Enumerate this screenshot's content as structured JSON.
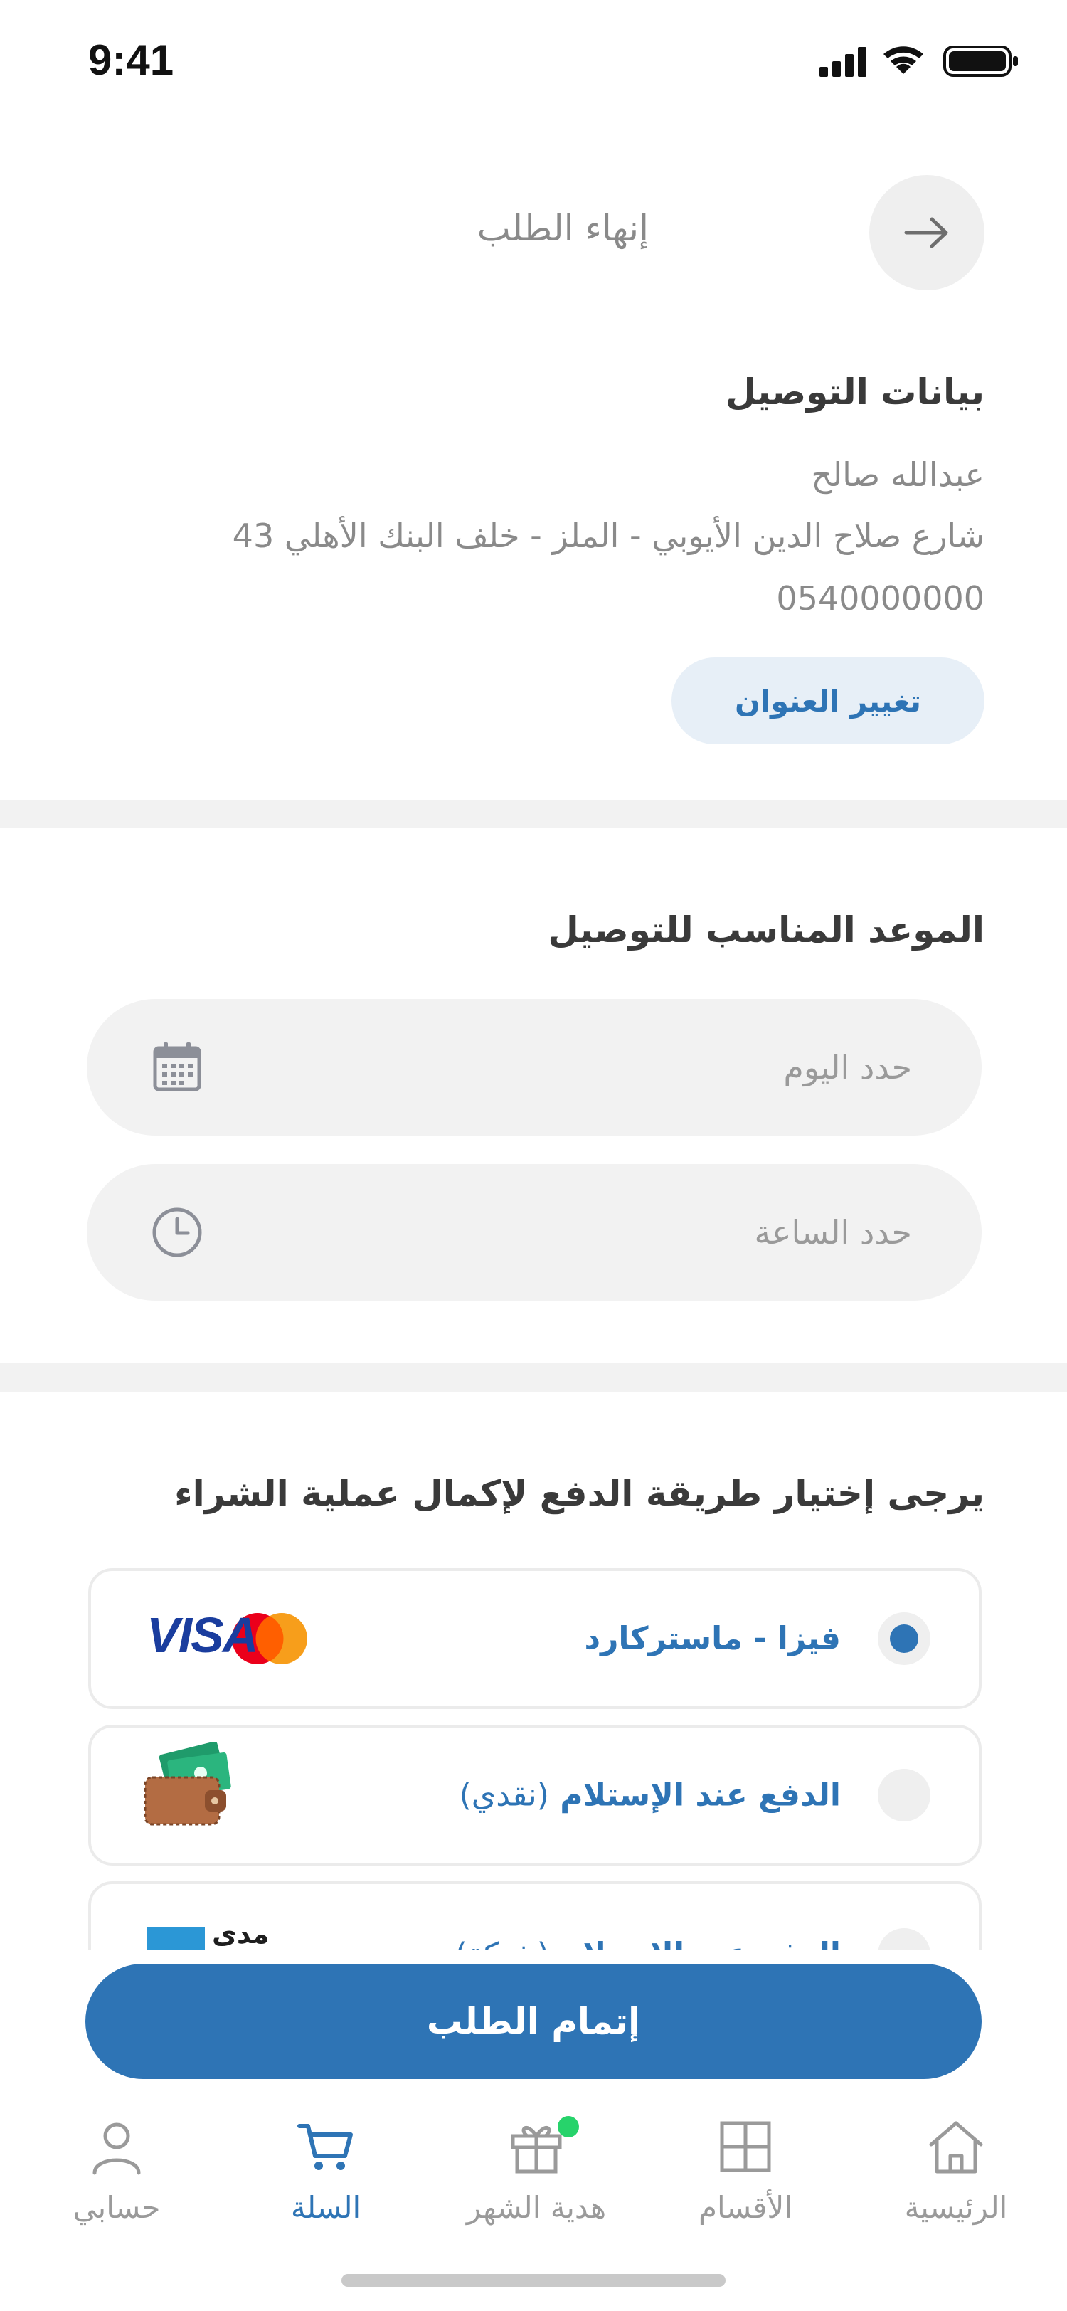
{
  "status_bar": {
    "time": "9:41"
  },
  "header": {
    "title": "إنهاء الطلب"
  },
  "delivery": {
    "heading": "بيانات التوصيل",
    "name": "عبدالله صالح",
    "address": "شارع صلاح الدين الأيوبي - الملز - خلف البنك الأهلي 43",
    "phone": "0540000000",
    "change_button": "تغيير العنوان"
  },
  "schedule": {
    "heading": "الموعد المناسب للتوصيل",
    "day_placeholder": "حدد اليوم",
    "time_placeholder": "حدد الساعة"
  },
  "payment": {
    "heading": "يرجى إختيار طريقة الدفع لإكمال عملية الشراء",
    "methods": [
      {
        "label": "فيزا - ماستركارد",
        "sub": "",
        "selected": true,
        "logo_text": "VISA"
      },
      {
        "label": "الدفع عند الإستلام",
        "sub": "(نقدي)",
        "selected": false
      },
      {
        "label": "الدفع عند الإستلام",
        "sub": "(شبكة)",
        "selected": false,
        "logo_text": "مدى"
      }
    ]
  },
  "cta": {
    "label": "إتمام الطلب"
  },
  "bottom_nav": {
    "items": [
      {
        "label": "الرئيسية",
        "icon": "home-icon"
      },
      {
        "label": "الأقسام",
        "icon": "grid-icon"
      },
      {
        "label": "هدية الشهر",
        "icon": "gift-icon"
      },
      {
        "label": "السلة",
        "icon": "cart-icon",
        "active": true
      },
      {
        "label": "حسابي",
        "icon": "user-icon"
      }
    ]
  },
  "colors": {
    "accent": "#2e74b5",
    "badge": "#27d36b",
    "background": "#ffffff",
    "field": "#f2f2f2"
  }
}
